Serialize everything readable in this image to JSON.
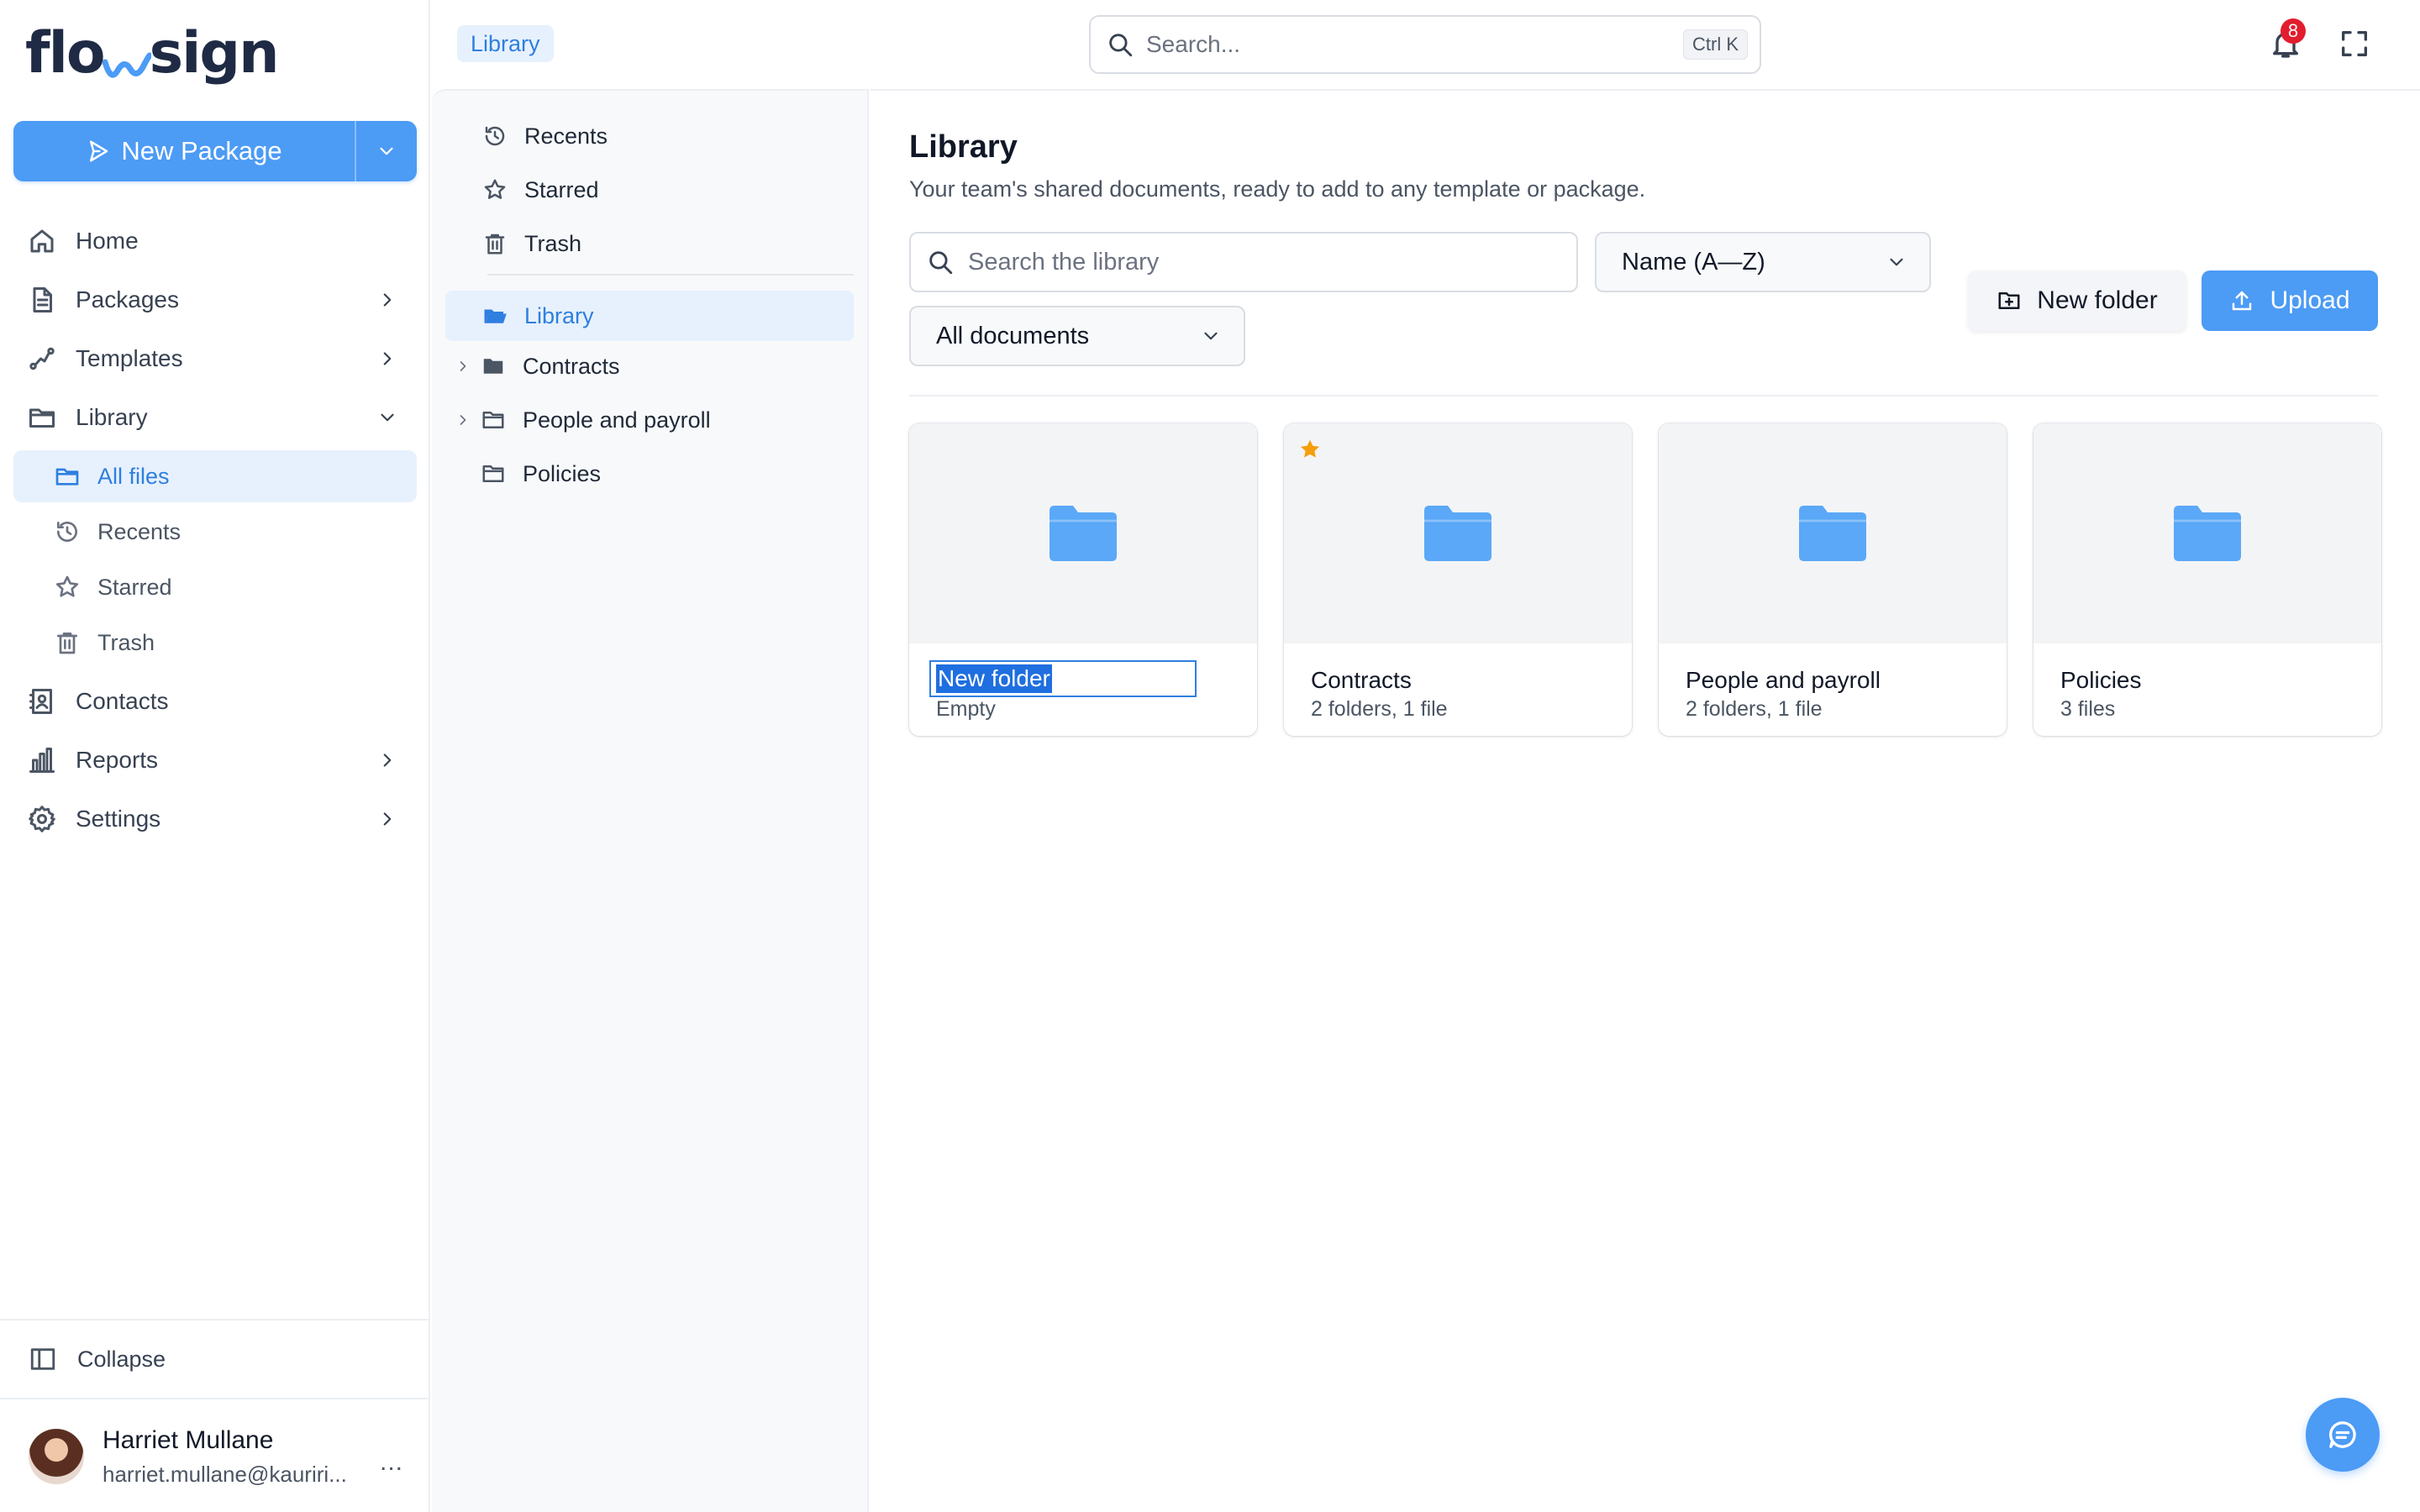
{
  "app": {
    "logo_text_1": "flo",
    "logo_text_2": "sign"
  },
  "colors": {
    "accent": "#4c9bf5",
    "accent_text": "#2e7fe0",
    "active_bg": "#e7f1fd",
    "star": "#f59e0b",
    "badge": "#e11d2e"
  },
  "sidebar": {
    "new_package_label": "New Package",
    "nav": [
      {
        "label": "Home",
        "icon": "home-icon"
      },
      {
        "label": "Packages",
        "icon": "document-icon"
      },
      {
        "label": "Templates",
        "icon": "route-icon"
      },
      {
        "label": "Library",
        "icon": "folder-icon",
        "expanded": true
      }
    ],
    "library_sub": [
      {
        "label": "All files",
        "icon": "folder-icon",
        "active": true
      },
      {
        "label": "Recents",
        "icon": "history-icon"
      },
      {
        "label": "Starred",
        "icon": "star-icon"
      },
      {
        "label": "Trash",
        "icon": "trash-icon"
      }
    ],
    "nav_bottom": [
      {
        "label": "Contacts",
        "icon": "contacts-icon"
      },
      {
        "label": "Reports",
        "icon": "chart-icon"
      },
      {
        "label": "Settings",
        "icon": "gear-icon"
      }
    ],
    "collapse_label": "Collapse",
    "user": {
      "name": "Harriet Mullane",
      "email": "harriet.mullane@kauriri...",
      "more": "..."
    }
  },
  "topbar": {
    "breadcrumb": "Library",
    "search_placeholder": "Search...",
    "search_shortcut": "Ctrl K",
    "notifications_count": "8"
  },
  "tree": {
    "quick": [
      {
        "label": "Recents",
        "icon": "history-icon"
      },
      {
        "label": "Starred",
        "icon": "star-icon"
      },
      {
        "label": "Trash",
        "icon": "trash-icon"
      }
    ],
    "root": {
      "label": "Library",
      "icon": "folder-open-icon",
      "active": true
    },
    "children": [
      {
        "label": "Contracts",
        "expandable": true,
        "icon": "folder-filled-icon"
      },
      {
        "label": "People and payroll",
        "expandable": true,
        "icon": "folder-icon"
      },
      {
        "label": "Policies",
        "expandable": false,
        "icon": "folder-icon"
      }
    ]
  },
  "main": {
    "title": "Library",
    "subtitle": "Your team's shared documents, ready to add to any template or package.",
    "search_placeholder": "Search the library",
    "sort_value": "Name (A—Z)",
    "filter_value": "All documents",
    "new_folder_label": "New folder",
    "upload_label": "Upload",
    "cards": [
      {
        "name": "New folder",
        "meta": "Empty",
        "renaming": true,
        "starred": false
      },
      {
        "name": "Contracts",
        "meta": "2 folders, 1 file",
        "renaming": false,
        "starred": true
      },
      {
        "name": "People and payroll",
        "meta": "2 folders, 1 file",
        "renaming": false,
        "starred": false
      },
      {
        "name": "Policies",
        "meta": "3 files",
        "renaming": false,
        "starred": false
      }
    ]
  }
}
